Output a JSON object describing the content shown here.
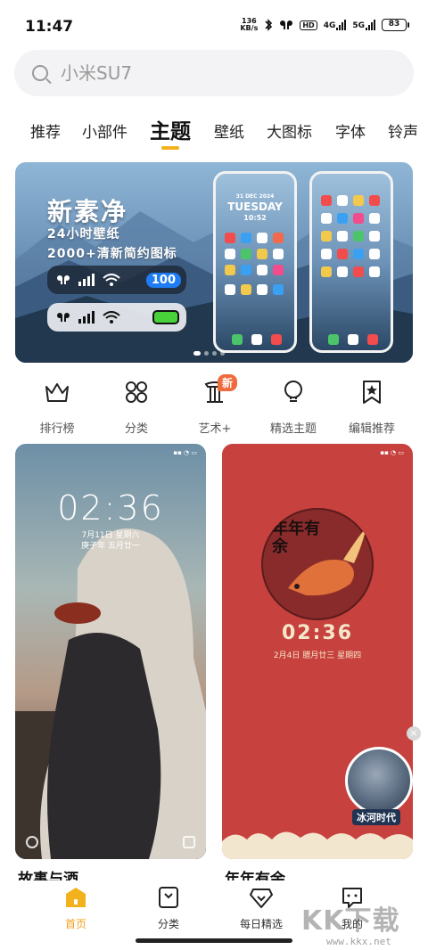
{
  "status_bar": {
    "time": "11:47",
    "net_speed_value": "136",
    "net_speed_unit": "KB/s",
    "hd": "HD",
    "sim1": "4G",
    "sim2": "5G",
    "battery": "83"
  },
  "search": {
    "placeholder": "小米SU7"
  },
  "tabs": [
    {
      "label": "推荐"
    },
    {
      "label": "小部件"
    },
    {
      "label": "主题",
      "active": true
    },
    {
      "label": "壁纸"
    },
    {
      "label": "大图标"
    },
    {
      "label": "字体"
    },
    {
      "label": "铃声"
    }
  ],
  "banner": {
    "title": "新素净",
    "sub1": "24小时壁纸",
    "sub2": "2000+清新简约图标",
    "pill_number": "100",
    "phone_date": "31 DEC 2024",
    "phone_day": "TUESDAY",
    "phone_time": "10:52",
    "page_count": 4,
    "active_page": 1
  },
  "quick_links": [
    {
      "label": "排行榜",
      "icon": "crown-icon"
    },
    {
      "label": "分类",
      "icon": "grid-icon"
    },
    {
      "label": "艺术+",
      "icon": "pillar-icon",
      "badge": "新"
    },
    {
      "label": "精选主题",
      "icon": "bulb-icon"
    },
    {
      "label": "编辑推荐",
      "icon": "bookmark-star-icon"
    }
  ],
  "cards": [
    {
      "title": "故事与酒",
      "clock": "02:36",
      "date1": "7月11日 星期六",
      "date2": "庚子年 五月廿一"
    },
    {
      "title": "年年有余",
      "clock": "02:36",
      "date1": "2月4日 腊月廿三 星期四",
      "art_text": "年年有余"
    }
  ],
  "floating_ad": {
    "label": "冰河时代",
    "close": "×"
  },
  "bottom_nav": [
    {
      "label": "首页",
      "icon": "home-icon",
      "active": true
    },
    {
      "label": "分类",
      "icon": "category-icon"
    },
    {
      "label": "每日精选",
      "icon": "diamond-icon"
    },
    {
      "label": "我的",
      "icon": "profile-icon"
    }
  ],
  "watermark": {
    "text": "KK下载",
    "url": "www.kkx.net"
  },
  "colors": {
    "accent": "#f2b21d",
    "badge": "#ef6a3c",
    "card_red": "#c7413e"
  }
}
